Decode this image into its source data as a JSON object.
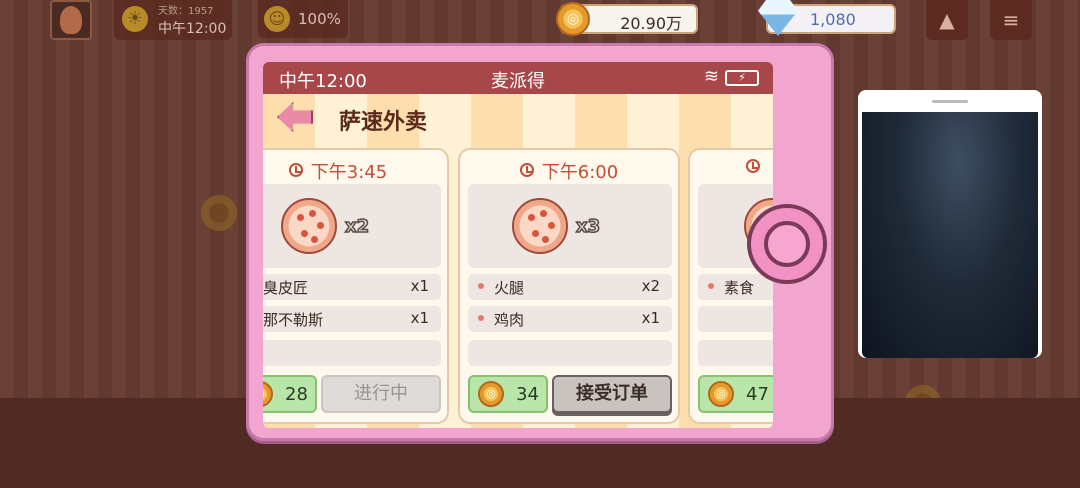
{
  "hud": {
    "day_count": "天数：1957",
    "time": "中午12:00",
    "happiness": "100%",
    "coins": "20.90万",
    "gems": "1,080"
  },
  "tablet": {
    "status_time": "中午12:00",
    "status_title": "麦派得",
    "app_title": "萨速外卖"
  },
  "orders": [
    {
      "time": "下午3:45",
      "pizza_qty": "x2",
      "toppings": [
        {
          "name": "臭皮匠",
          "qty": "x1"
        },
        {
          "name": "那不勒斯",
          "qty": "x1"
        }
      ],
      "reward": "28",
      "action": "进行中",
      "action_state": "in-progress"
    },
    {
      "time": "下午6:00",
      "pizza_qty": "x3",
      "toppings": [
        {
          "name": "火腿",
          "qty": "x2"
        },
        {
          "name": "鸡肉",
          "qty": "x1"
        }
      ],
      "reward": "34",
      "action": "接受订单",
      "action_state": "accept"
    },
    {
      "time": "",
      "pizza_qty": "",
      "toppings": [
        {
          "name": "素食",
          "qty": ""
        }
      ],
      "reward": "47",
      "action": "",
      "action_state": "unknown"
    }
  ],
  "colors": {
    "status_bar": "#a8474a",
    "tablet": "#f2a6cf",
    "reward_bg": "#b8e6a8",
    "gem_text": "#4a6fae"
  }
}
